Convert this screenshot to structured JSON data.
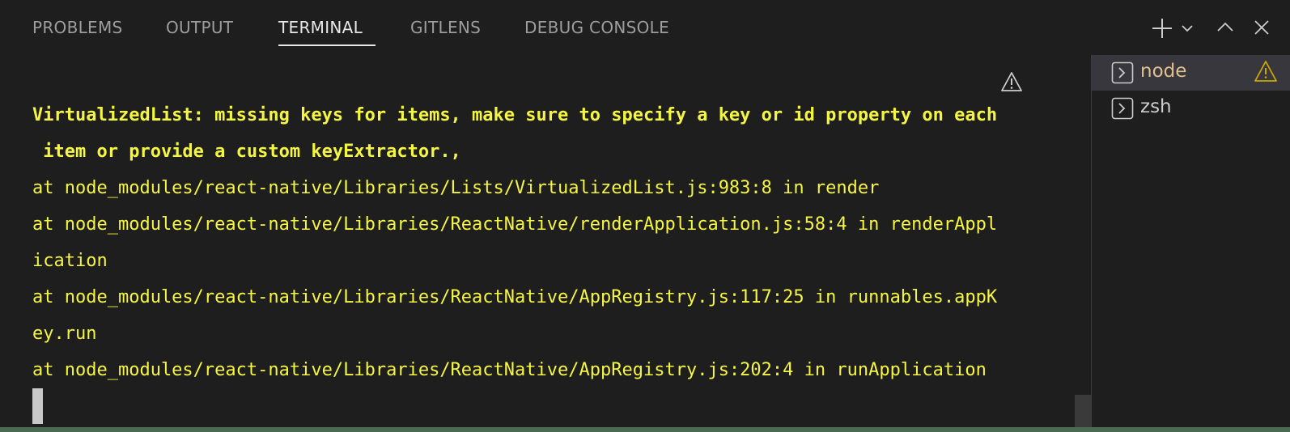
{
  "tabs": [
    {
      "label": "PROBLEMS"
    },
    {
      "label": "OUTPUT"
    },
    {
      "label": "TERMINAL"
    },
    {
      "label": "GITLENS"
    },
    {
      "label": "DEBUG CONSOLE"
    }
  ],
  "active_tab": "TERMINAL",
  "actions": {
    "new_terminal_icon": "plus-icon",
    "dropdown_icon": "chevron-down-icon",
    "maximize_icon": "chevron-up-icon",
    "close_icon": "close-icon"
  },
  "terminal": {
    "lines": [
      "VirtualizedList: missing keys for items, make sure to specify a key or id property on each",
      " item or provide a custom keyExtractor.,",
      "at node_modules/react-native/Libraries/Lists/VirtualizedList.js:983:8 in render",
      "at node_modules/react-native/Libraries/ReactNative/renderApplication.js:58:4 in renderAppl",
      "ication",
      "at node_modules/react-native/Libraries/ReactNative/AppRegistry.js:117:25 in runnables.appK",
      "ey.run",
      "at node_modules/react-native/Libraries/ReactNative/AppRegistry.js:202:4 in runApplication"
    ],
    "text_color": "#f5f543",
    "warning_icon": "warning-icon"
  },
  "sidebar": {
    "items": [
      {
        "label": "node",
        "icon": "terminal-icon",
        "color": "#e2c08d",
        "warning": true
      },
      {
        "label": "zsh",
        "icon": "terminal-icon",
        "color": "#cccccc",
        "warning": false
      }
    ]
  },
  "colors": {
    "background": "#1e1e1e",
    "warning": "#cca700",
    "status_bar": "#4a6a52"
  }
}
